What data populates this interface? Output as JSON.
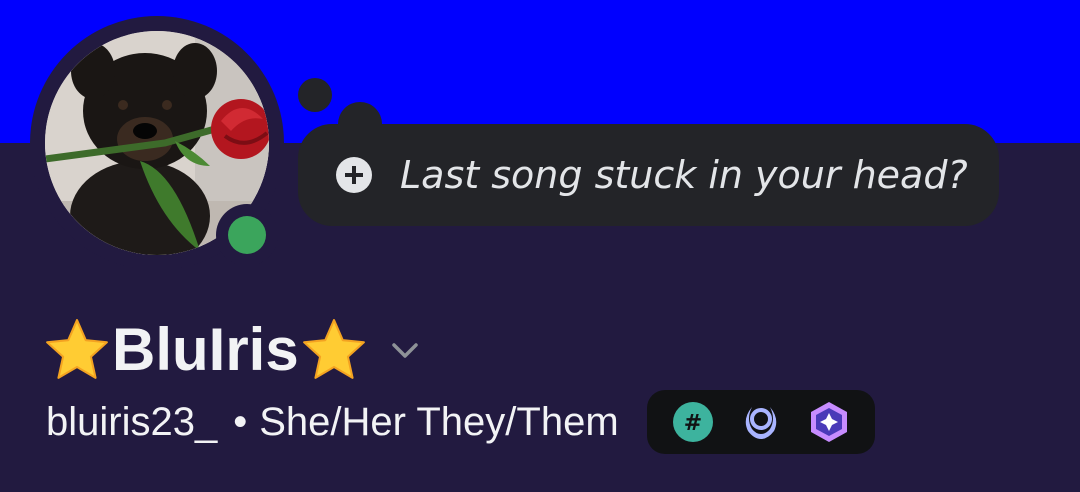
{
  "profile": {
    "display_name": "BluIris",
    "username": "bluiris23_",
    "separator": "•",
    "pronouns": "She/Her They/Them",
    "online_status": "online",
    "custom_status_placeholder": "Last song stuck in your head?",
    "badges": [
      {
        "icon": "hashtag-badge-icon"
      },
      {
        "icon": "laurel-wreath-badge-icon"
      },
      {
        "icon": "nitro-gem-badge-icon"
      }
    ]
  },
  "colors": {
    "banner": "#0000ff",
    "background": "#221a40",
    "status_online": "#3ba55c",
    "bubble": "#232428",
    "badge_tray": "#111214"
  }
}
